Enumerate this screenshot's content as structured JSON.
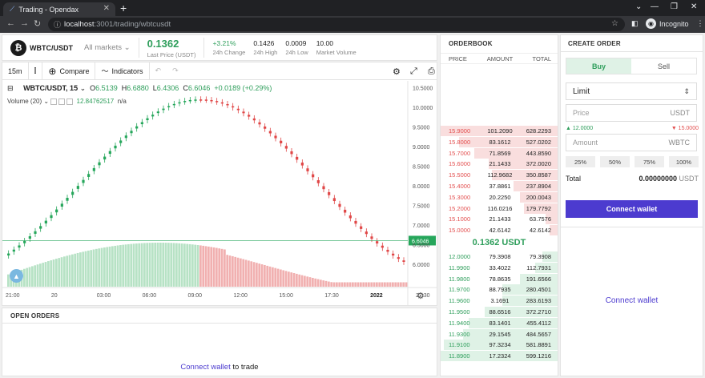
{
  "browser": {
    "tab_title": "Trading - Opendax",
    "url_host": "localhost",
    "url_path": ":3001/trading/wbtcusdt",
    "profile": "Incognito"
  },
  "market": {
    "pair": "WBTC/USDT",
    "all_markets": "All markets",
    "last_price": "0.1362",
    "last_price_label": "Last Price (USDT)",
    "change": "+3.21%",
    "change_label": "24h Change",
    "high": "0.1426",
    "high_label": "24h High",
    "low": "0.0009",
    "low_label": "24h Low",
    "volume": "10.00",
    "volume_label": "Market Volume"
  },
  "chart": {
    "interval": "15m",
    "compare": "Compare",
    "indicators": "Indicators",
    "legend_symbol": "WBTC/USDT, 15",
    "o_label": "O",
    "o": "6.5139",
    "h_label": "H",
    "h": "6.6880",
    "l_label": "L",
    "l": "6.4306",
    "c_label": "C",
    "c": "6.6046",
    "chg": "+0.0189 (+0.29%)",
    "volume_legend": "Volume (20)",
    "volume_value": "12.84762517",
    "volume_na": "n/a",
    "price_badge": "6.6046"
  },
  "chart_data": {
    "type": "candlestick",
    "y_ticks": [
      "10.5000",
      "10.0000",
      "9.5000",
      "9.0000",
      "8.5000",
      "8.0000",
      "7.5000",
      "7.0000",
      "6.5000",
      "6.0000"
    ],
    "x_ticks": [
      "21:00",
      "20",
      "03:00",
      "06:00",
      "09:00",
      "12:00",
      "15:00",
      "17:30",
      "2022",
      "22:30"
    ],
    "ylim": [
      5.9,
      10.55
    ],
    "last_close": 6.6046,
    "colors": {
      "up": "#26a65b",
      "down": "#e04747",
      "vol_up": "#b7e2c5",
      "vol_down": "#f1b0b0"
    }
  },
  "orders": {
    "title": "OPEN ORDERS",
    "connect_link": "Connect wallet",
    "connect_rest": " to trade"
  },
  "orderbook": {
    "title": "ORDERBOOK",
    "headers": [
      "PRICE",
      "AMOUNT",
      "TOTAL"
    ],
    "asks": [
      {
        "price": "15.9000",
        "amount": "101.2090",
        "total": "628.2293",
        "depth": 1.0
      },
      {
        "price": "15.8000",
        "amount": "83.1612",
        "total": "527.0202",
        "depth": 0.84
      },
      {
        "price": "15.7000",
        "amount": "71.8569",
        "total": "443.8590",
        "depth": 0.71
      },
      {
        "price": "15.6000",
        "amount": "21.1433",
        "total": "372.0020",
        "depth": 0.59
      },
      {
        "price": "15.5000",
        "amount": "112.9682",
        "total": "350.8587",
        "depth": 0.56
      },
      {
        "price": "15.4000",
        "amount": "37.8861",
        "total": "237.8904",
        "depth": 0.38
      },
      {
        "price": "15.3000",
        "amount": "20.2250",
        "total": "200.0043",
        "depth": 0.32
      },
      {
        "price": "15.2000",
        "amount": "116.0216",
        "total": "179.7792",
        "depth": 0.29
      },
      {
        "price": "15.1000",
        "amount": "21.1433",
        "total": "63.7576",
        "depth": 0.1
      },
      {
        "price": "15.0000",
        "amount": "42.6142",
        "total": "42.6142",
        "depth": 0.07
      }
    ],
    "mid_price": "0.1362 USDT",
    "bids": [
      {
        "price": "12.0000",
        "amount": "79.3908",
        "total": "79.3908",
        "depth": 0.13
      },
      {
        "price": "11.9900",
        "amount": "33.4022",
        "total": "112.7931",
        "depth": 0.19
      },
      {
        "price": "11.9800",
        "amount": "78.8635",
        "total": "191.6566",
        "depth": 0.32
      },
      {
        "price": "11.9700",
        "amount": "88.7935",
        "total": "280.4501",
        "depth": 0.47
      },
      {
        "price": "11.9600",
        "amount": "3.1691",
        "total": "283.6193",
        "depth": 0.47
      },
      {
        "price": "11.9500",
        "amount": "88.6516",
        "total": "372.2710",
        "depth": 0.62
      },
      {
        "price": "11.9400",
        "amount": "83.1401",
        "total": "455.4112",
        "depth": 0.76
      },
      {
        "price": "11.9300",
        "amount": "29.1545",
        "total": "484.5657",
        "depth": 0.81
      },
      {
        "price": "11.9100",
        "amount": "97.3234",
        "total": "581.8891",
        "depth": 0.97
      },
      {
        "price": "11.8900",
        "amount": "17.2324",
        "total": "599.1216",
        "depth": 1.0
      }
    ]
  },
  "create_order": {
    "title": "CREATE ORDER",
    "buy": "Buy",
    "sell": "Sell",
    "type": "Limit",
    "price_placeholder": "Price",
    "price_unit": "USDT",
    "min": "▲ 12.0000",
    "max": "▼ 15.0000",
    "amount_placeholder": "Amount",
    "amount_unit": "WBTC",
    "pcts": [
      "25%",
      "50%",
      "75%",
      "100%"
    ],
    "total_label": "Total",
    "total_value": "0.00000000",
    "total_unit": " USDT",
    "connect_button": "Connect wallet",
    "connect_link": "Connect wallet"
  }
}
